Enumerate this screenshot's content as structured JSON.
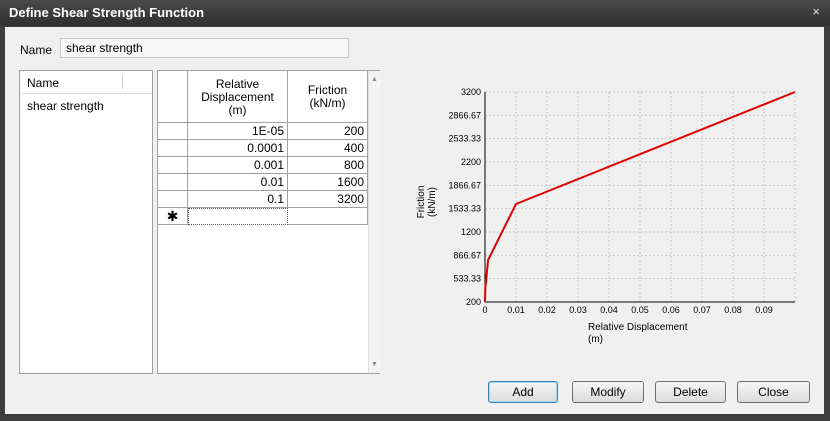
{
  "window": {
    "title": "Define Shear Strength Function",
    "close_glyph": "×"
  },
  "name_field": {
    "label": "Name",
    "value": "shear strength"
  },
  "function_list": {
    "header": "Name",
    "items": [
      "shear strength"
    ]
  },
  "table": {
    "headers": [
      {
        "lines": [
          "Relative",
          "Displacement",
          "(m)"
        ]
      },
      {
        "lines": [
          "Friction",
          "(kN/m)"
        ]
      }
    ],
    "rows": [
      [
        "1E-05",
        "200"
      ],
      [
        "0.0001",
        "400"
      ],
      [
        "0.001",
        "800"
      ],
      [
        "0.01",
        "1600"
      ],
      [
        "0.1",
        "3200"
      ]
    ],
    "new_row_marker": "✱"
  },
  "buttons": {
    "add": "Add",
    "modify": "Modify",
    "delete": "Delete",
    "close": "Close"
  },
  "colors": {
    "series": "#e00000",
    "titlebar": "#3a3a3a",
    "accent": "#3c7fb1"
  },
  "chart_data": {
    "type": "line",
    "xlabel": "Relative Displacement\n(m)",
    "ylabel": "Friction\n(kN/m)",
    "xlim": [
      0,
      0.1
    ],
    "ylim": [
      200,
      3200
    ],
    "x_ticks": [
      "0",
      "0.01",
      "0.02",
      "0.03",
      "0.04",
      "0.05",
      "0.06",
      "0.07",
      "0.08",
      "0.09"
    ],
    "x_tick_values": [
      0,
      0.01,
      0.02,
      0.03,
      0.04,
      0.05,
      0.06,
      0.07,
      0.08,
      0.09
    ],
    "y_ticks": [
      "200",
      "533.33",
      "866.67",
      "1200",
      "1533.33",
      "1866.67",
      "2200",
      "2533.33",
      "2866.67",
      "3200"
    ],
    "y_tick_values": [
      200,
      533.33,
      866.67,
      1200,
      1533.33,
      1866.67,
      2200,
      2533.33,
      2866.67,
      3200
    ],
    "grid": true,
    "series": [
      {
        "x": [
          1e-05,
          0.0001,
          0.001,
          0.01,
          0.1
        ],
        "y": [
          200,
          400,
          800,
          1600,
          3200
        ]
      }
    ]
  }
}
